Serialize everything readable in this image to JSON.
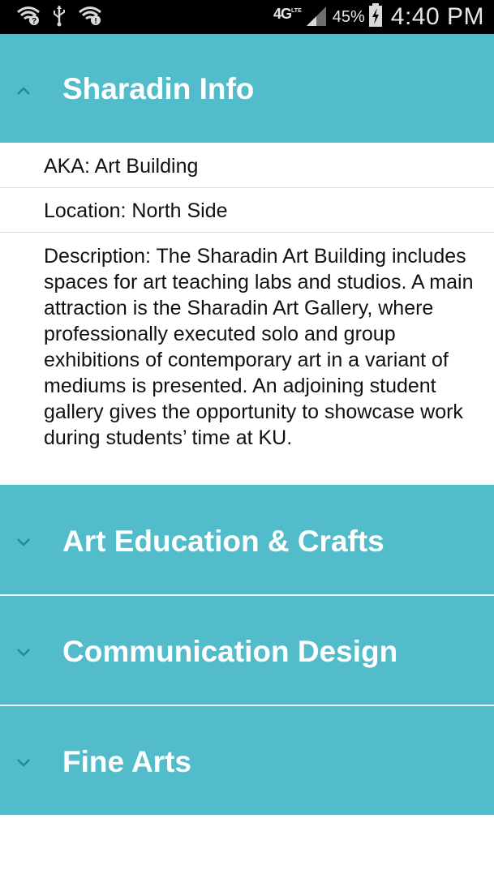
{
  "status_bar": {
    "network": "4G",
    "network_sub": "LTE",
    "battery_percent": "45%",
    "time": "4:40 PM",
    "icons": [
      "wifi-question-icon",
      "usb-icon",
      "wifi-icon",
      "network-4g-lte-icon",
      "signal-icon",
      "battery-charging-icon"
    ]
  },
  "accordion": {
    "expanded": {
      "title": "Sharadin Info",
      "details": {
        "aka": "AKA: Art Building",
        "location": "Location: North Side",
        "description": "Description: The Sharadin Art Building includes spaces for art teaching labs and studios. A main attraction is the Sharadin Art Gallery, where professionally executed solo and group exhibitions of contemporary art in a variant of mediums is presented.  An adjoining student gallery gives the opportunity to showcase work during students’ time at KU."
      }
    },
    "collapsed": [
      {
        "title": "Art Education & Crafts"
      },
      {
        "title": "Communication Design"
      },
      {
        "title": "Fine Arts"
      }
    ]
  },
  "colors": {
    "header_bg": "#52bccb",
    "header_text": "#ffffff",
    "status_bar_bg": "#000000"
  }
}
